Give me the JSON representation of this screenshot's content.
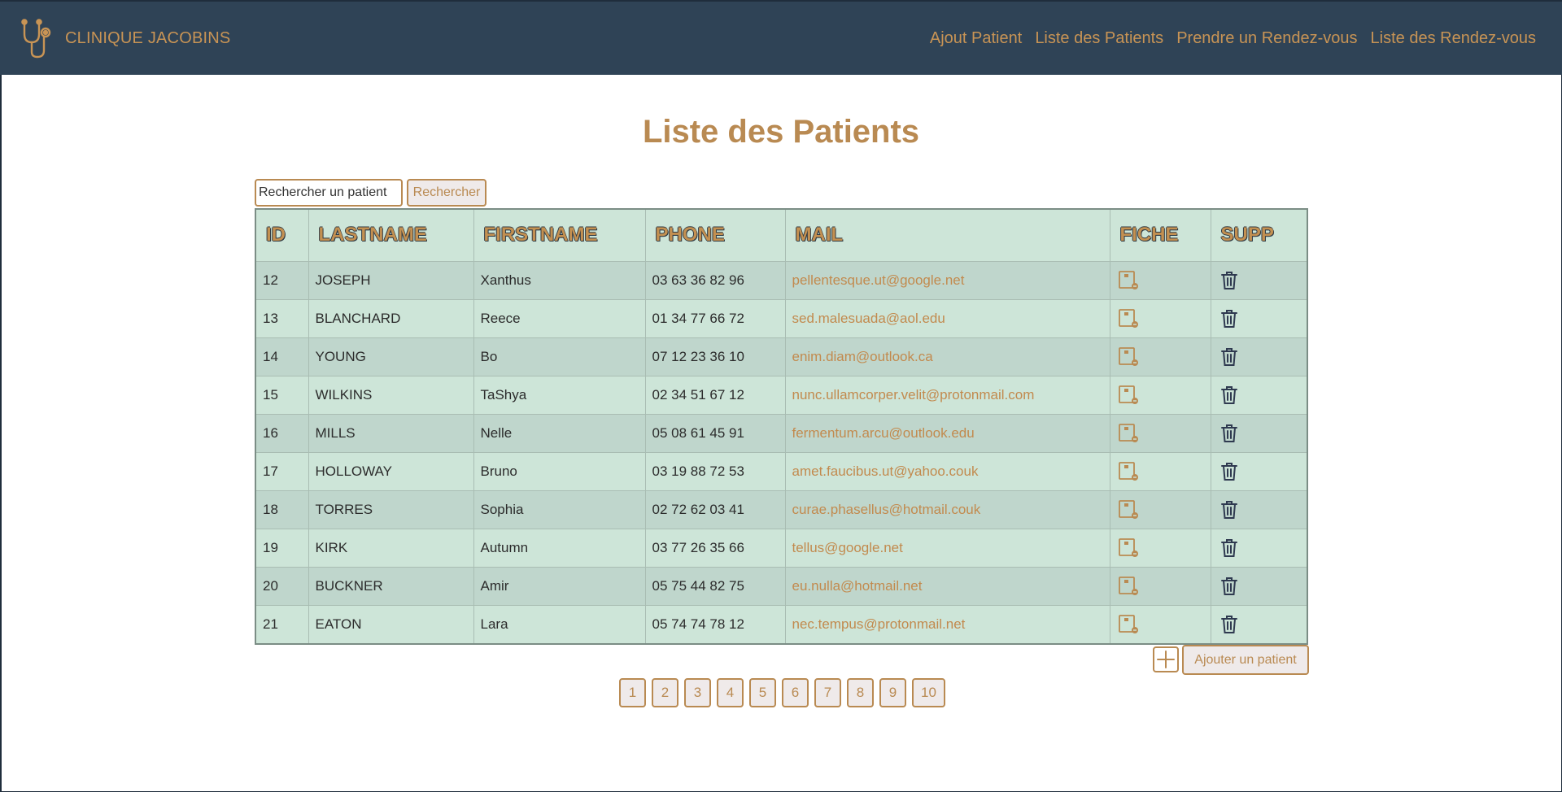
{
  "brand": {
    "name": "CLINIQUE JACOBINS",
    "logo_icon": "stethoscope-icon"
  },
  "nav": [
    {
      "label": "Ajout Patient"
    },
    {
      "label": "Liste des Patients"
    },
    {
      "label": "Prendre un Rendez-vous"
    },
    {
      "label": "Liste des Rendez-vous"
    }
  ],
  "page_title": "Liste des Patients",
  "search": {
    "placeholder": "Rechercher un patient",
    "value": "",
    "button_label": "Rechercher"
  },
  "table": {
    "headers": [
      "ID",
      "LASTNAME",
      "FIRSTNAME",
      "PHONE",
      "MAIL",
      "FICHE",
      "SUPP"
    ],
    "rows": [
      {
        "id": "12",
        "lastname": "JOSEPH",
        "firstname": "Xanthus",
        "phone": "03 63 36 82 96",
        "mail": "pellentesque.ut@google.net"
      },
      {
        "id": "13",
        "lastname": "BLANCHARD",
        "firstname": "Reece",
        "phone": "01 34 77 66 72",
        "mail": "sed.malesuada@aol.edu"
      },
      {
        "id": "14",
        "lastname": "YOUNG",
        "firstname": "Bo",
        "phone": "07 12 23 36 10",
        "mail": "enim.diam@outlook.ca"
      },
      {
        "id": "15",
        "lastname": "WILKINS",
        "firstname": "TaShya",
        "phone": "02 34 51 67 12",
        "mail": "nunc.ullamcorper.velit@protonmail.com"
      },
      {
        "id": "16",
        "lastname": "MILLS",
        "firstname": "Nelle",
        "phone": "05 08 61 45 91",
        "mail": "fermentum.arcu@outlook.edu"
      },
      {
        "id": "17",
        "lastname": "HOLLOWAY",
        "firstname": "Bruno",
        "phone": "03 19 88 72 53",
        "mail": "amet.faucibus.ut@yahoo.couk"
      },
      {
        "id": "18",
        "lastname": "TORRES",
        "firstname": "Sophia",
        "phone": "02 72 62 03 41",
        "mail": "curae.phasellus@hotmail.couk"
      },
      {
        "id": "19",
        "lastname": "KIRK",
        "firstname": "Autumn",
        "phone": "03 77 26 35 66",
        "mail": "tellus@google.net"
      },
      {
        "id": "20",
        "lastname": "BUCKNER",
        "firstname": "Amir",
        "phone": "05 75 44 82 75",
        "mail": "eu.nulla@hotmail.net"
      },
      {
        "id": "21",
        "lastname": "EATON",
        "firstname": "Lara",
        "phone": "05 74 74 78 12",
        "mail": "nec.tempus@protonmail.net"
      }
    ],
    "fiche_icon": "patient-file-icon",
    "supp_icon": "trash-icon"
  },
  "add_patient": {
    "icon": "plus-icon",
    "label": "Ajouter un patient"
  },
  "pagination": [
    "1",
    "2",
    "3",
    "4",
    "5",
    "6",
    "7",
    "8",
    "9",
    "10"
  ],
  "colors": {
    "navbar": "#2f4356",
    "accent": "#c89455",
    "row_dark": "#bfd6cc",
    "row_light": "#cde5d8"
  }
}
